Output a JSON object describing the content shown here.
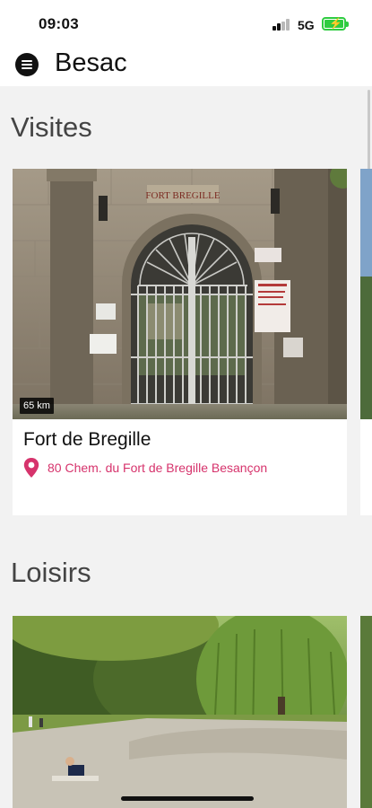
{
  "status_bar": {
    "time": "09:03",
    "network": "5G",
    "icons": [
      "signal-icon",
      "battery-charging-icon"
    ]
  },
  "header": {
    "title": "Besac",
    "menu_icon": "menu-icon"
  },
  "sections": [
    {
      "title": "Visites",
      "cards": [
        {
          "name": "Fort de Bregille",
          "address": "80 Chem. du Fort de Bregille Besançon",
          "distance": "65 km",
          "sign_text": "FORT BREGILLE"
        }
      ]
    },
    {
      "title": "Loisirs",
      "cards": [
        {
          "name": "",
          "address": "",
          "distance": ""
        }
      ]
    }
  ],
  "colors": {
    "accent": "#d6336c",
    "background": "#f2f2f2",
    "battery": "#2ecc40"
  }
}
